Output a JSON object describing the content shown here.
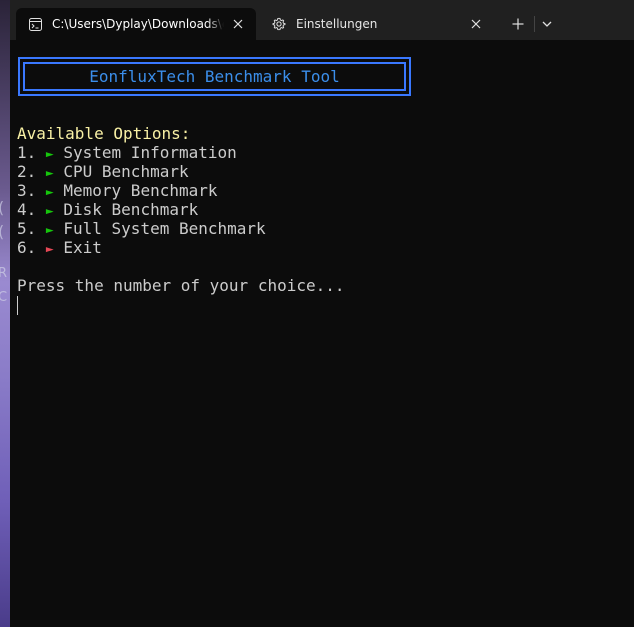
{
  "tabs": [
    {
      "label": "C:\\Users\\Dyplay\\Downloads\\e",
      "icon": "terminal-icon",
      "active": true
    },
    {
      "label": "Einstellungen",
      "icon": "gear-icon",
      "active": false
    }
  ],
  "titlebar": {
    "new_tab": "+",
    "dropdown": "chevron-down-icon"
  },
  "terminal": {
    "banner_title": "EonfluxTech Benchmark Tool",
    "options_heading": "Available Options:",
    "options": [
      {
        "number": "1.",
        "arrow": "►",
        "label": "System Information",
        "arrow_color": "#16c60c"
      },
      {
        "number": "2.",
        "arrow": "►",
        "label": "CPU Benchmark",
        "arrow_color": "#16c60c"
      },
      {
        "number": "3.",
        "arrow": "►",
        "label": "Memory Benchmark",
        "arrow_color": "#16c60c"
      },
      {
        "number": "4.",
        "arrow": "►",
        "label": "Disk Benchmark",
        "arrow_color": "#16c60c"
      },
      {
        "number": "5.",
        "arrow": "►",
        "label": "Full System Benchmark",
        "arrow_color": "#16c60c"
      },
      {
        "number": "6.",
        "arrow": "►",
        "label": "Exit",
        "arrow_color": "#e74856"
      }
    ],
    "prompt": "Press the number of your choice..."
  },
  "colors": {
    "banner_border": "#3a78ff",
    "banner_text": "#3b8eea",
    "heading_text": "#f9f1a5",
    "terminal_bg": "#0c0c0c",
    "titlebar_bg": "#202020"
  }
}
